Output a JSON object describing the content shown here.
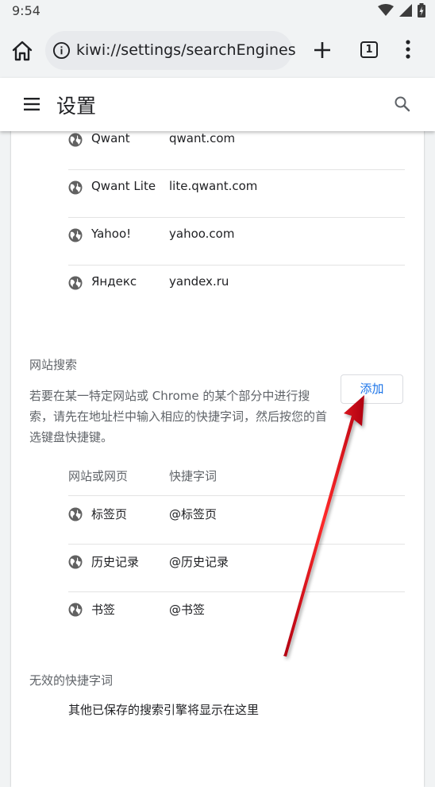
{
  "status_bar": {
    "time": "9:54"
  },
  "toolbar": {
    "url": "kiwi://settings/searchEngines",
    "tab_count": "1"
  },
  "header": {
    "title": "设置"
  },
  "engines": [
    {
      "name": "Qwant",
      "keyword": "qwant.com"
    },
    {
      "name": "Qwant Lite",
      "keyword": "lite.qwant.com"
    },
    {
      "name": "Yahoo!",
      "keyword": "yahoo.com"
    },
    {
      "name": "Яндекс",
      "keyword": "yandex.ru"
    }
  ],
  "site_search": {
    "title": "网站搜索",
    "description": "若要在某一特定网站或 Chrome 的某个部分中进行搜索，请先在地址栏中输入相应的快捷字词，然后按您的首选键盘快捷键。",
    "add_label": "添加",
    "col_site": "网站或网页",
    "col_shortcut": "快捷字词",
    "items": [
      {
        "name": "标签页",
        "keyword": "@标签页"
      },
      {
        "name": "历史记录",
        "keyword": "@历史记录"
      },
      {
        "name": "书签",
        "keyword": "@书签"
      }
    ]
  },
  "inactive": {
    "title": "无效的快捷字词",
    "empty_text": "其他已保存的搜索引擎将显示在这里"
  },
  "colors": {
    "accent": "#1a73e8",
    "annotation_arrow": "#e8141b"
  }
}
